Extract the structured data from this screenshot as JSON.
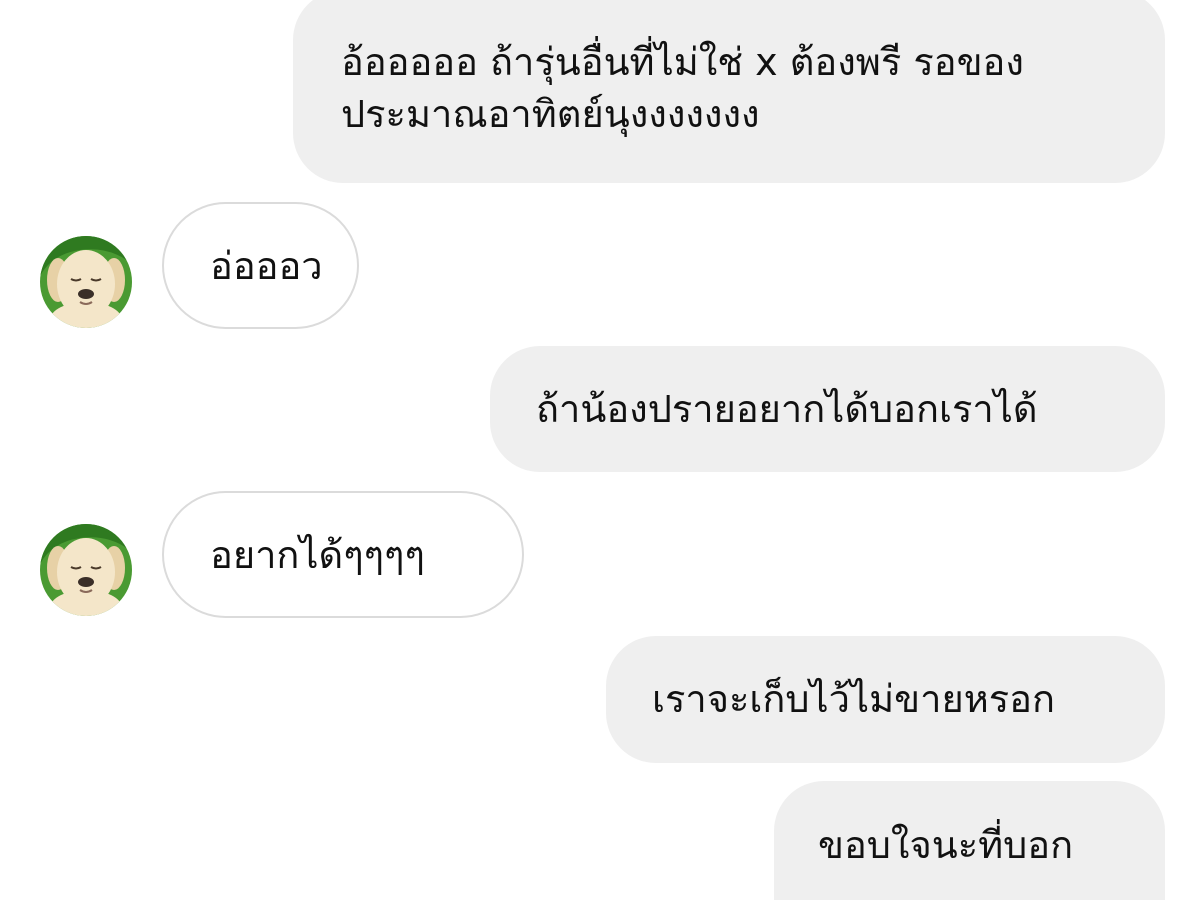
{
  "messages": [
    {
      "side": "outgoing",
      "text": "อ้อออออ ถ้ารุ่นอื่นที่ไม่ใช่ x ต้องพรี รอของ\nประมาณอาทิตย์นุงงงงงงง"
    },
    {
      "side": "incoming",
      "text": "อ่อออว",
      "avatar": "puppy-avatar"
    },
    {
      "side": "outgoing",
      "text": "ถ้าน้องปรายอยากได้บอกเราได้"
    },
    {
      "side": "incoming",
      "text": "อยากได้ๆๆๆๆ",
      "avatar": "puppy-avatar"
    },
    {
      "side": "outgoing",
      "text": "เราจะเก็บไว้ไม่ขายหรอก"
    },
    {
      "side": "outgoing",
      "text": "ขอบใจนะที่บอก"
    }
  ],
  "colors": {
    "outgoing_bubble": "#efefef",
    "incoming_border": "#dbdbdb",
    "text": "#111111",
    "avatar_ring": "#4a9a32"
  }
}
